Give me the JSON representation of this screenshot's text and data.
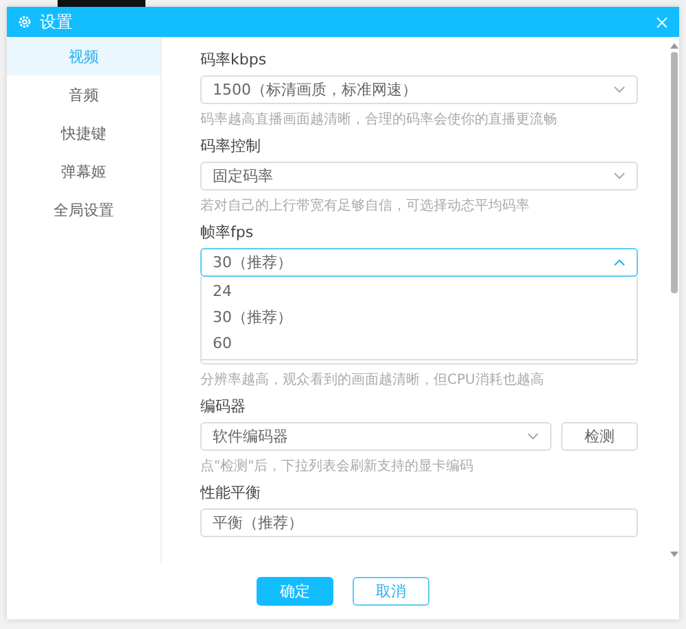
{
  "window": {
    "title": "设置"
  },
  "sidebar": {
    "items": [
      {
        "label": "视频",
        "selected": true
      },
      {
        "label": "音频",
        "selected": false
      },
      {
        "label": "快捷键",
        "selected": false
      },
      {
        "label": "弹幕姬",
        "selected": false
      },
      {
        "label": "全局设置",
        "selected": false
      }
    ]
  },
  "fields": [
    {
      "kind": "select",
      "label": "码率kbps",
      "value": "1500（标清画质，标准网速）",
      "hint": "码率越高直播画面越清晰，合理的码率会使你的直播更流畅",
      "expanded": false
    },
    {
      "kind": "select",
      "label": "码率控制",
      "value": "固定码率",
      "hint": "若对自己的上行带宽有足够自信，可选择动态平均码率",
      "expanded": false
    },
    {
      "kind": "select",
      "label": "帧率fps",
      "value": "30（推荐）",
      "expanded": true,
      "options": [
        "24",
        "30（推荐）",
        "60"
      ]
    },
    {
      "kind": "covered",
      "hint": "分辨率越高，观众看到的画面越清晰，但CPU消耗也越高"
    },
    {
      "kind": "select-button",
      "label": "编码器",
      "value": "软件编码器",
      "button": "检测",
      "hint": "点\"检测\"后，下拉列表会刷新支持的显卡编码",
      "expanded": false
    },
    {
      "kind": "input",
      "label": "性能平衡",
      "value": "平衡（推荐）"
    }
  ],
  "buttons": [
    {
      "label": "确定",
      "kind": "primary"
    },
    {
      "label": "取消",
      "kind": "secondary"
    }
  ]
}
